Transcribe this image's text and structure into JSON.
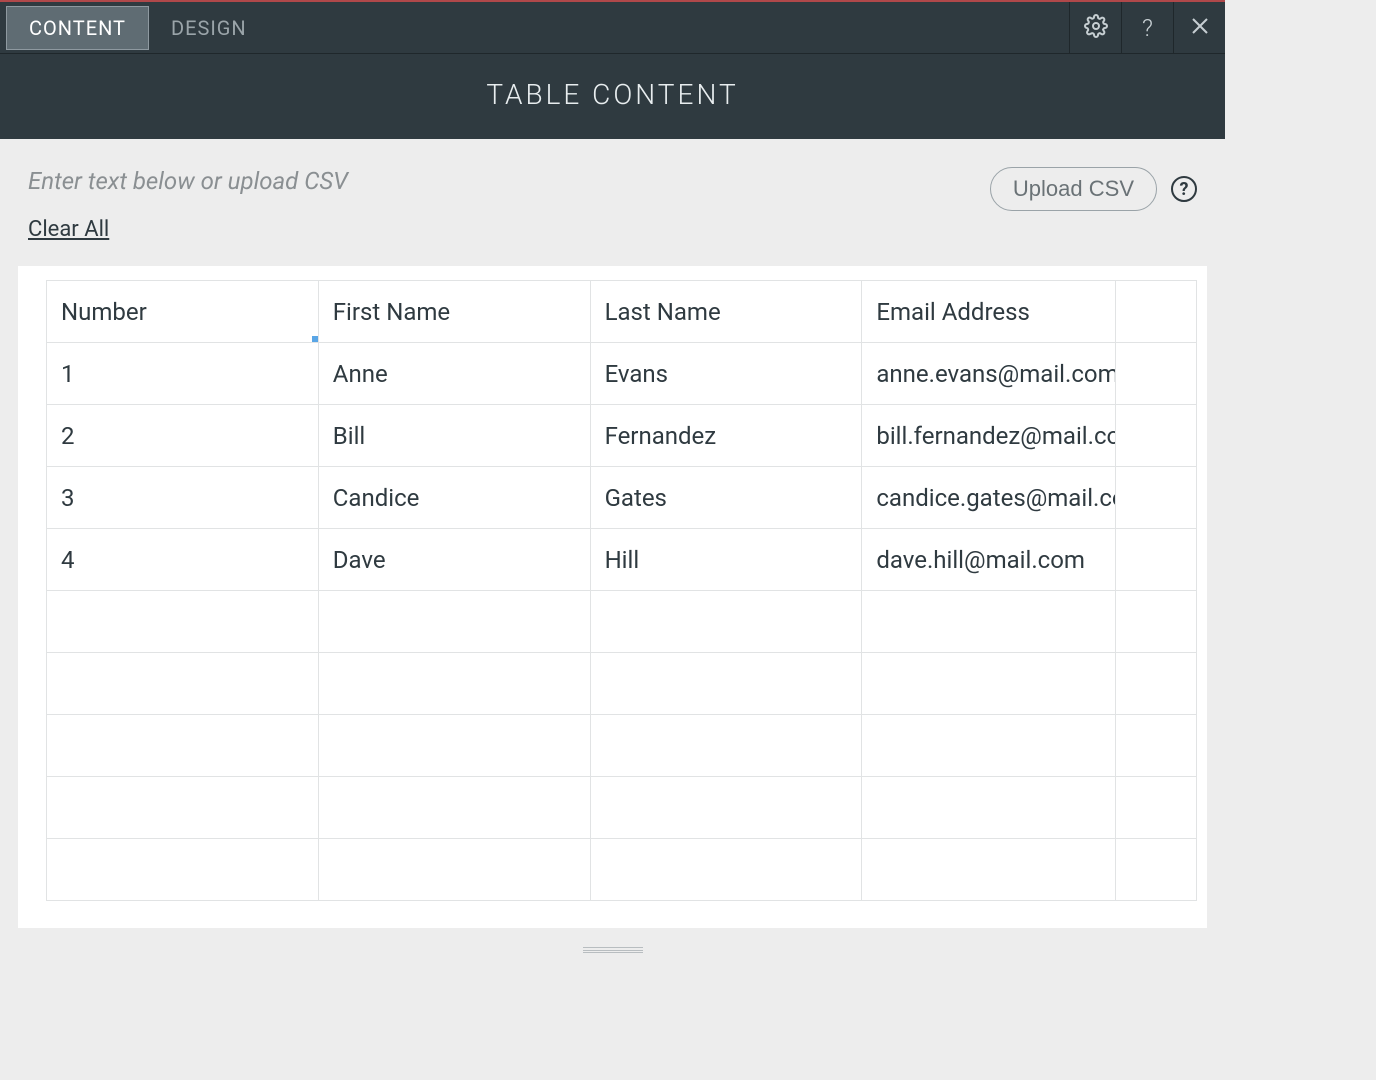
{
  "header": {
    "tabs": [
      {
        "label": "CONTENT",
        "active": true
      },
      {
        "label": "DESIGN",
        "active": false
      }
    ],
    "title": "TABLE CONTENT"
  },
  "toolbar": {
    "hint": "Enter text below or upload CSV",
    "clear_label": "Clear All",
    "upload_label": "Upload CSV",
    "help_glyph": "?"
  },
  "icons": {
    "settings": "gear-icon",
    "help": "?",
    "close": "close-icon"
  },
  "sheet": {
    "selected": {
      "row": 0,
      "col": 0
    },
    "columns": 5,
    "visible_rows": 10,
    "rows": [
      [
        "Number",
        "First Name",
        "Last Name",
        "Email Address",
        ""
      ],
      [
        "1",
        "Anne",
        "Evans",
        "anne.evans@mail.com",
        ""
      ],
      [
        "2",
        "Bill",
        "Fernandez",
        "bill.fernandez@mail.com",
        ""
      ],
      [
        "3",
        "Candice",
        "Gates",
        "candice.gates@mail.com",
        ""
      ],
      [
        "4",
        "Dave",
        "Hill",
        "dave.hill@mail.com",
        ""
      ],
      [
        "",
        "",
        "",
        "",
        ""
      ],
      [
        "",
        "",
        "",
        "",
        ""
      ],
      [
        "",
        "",
        "",
        "",
        ""
      ],
      [
        "",
        "",
        "",
        "",
        ""
      ],
      [
        "",
        "",
        "",
        "",
        ""
      ]
    ]
  }
}
